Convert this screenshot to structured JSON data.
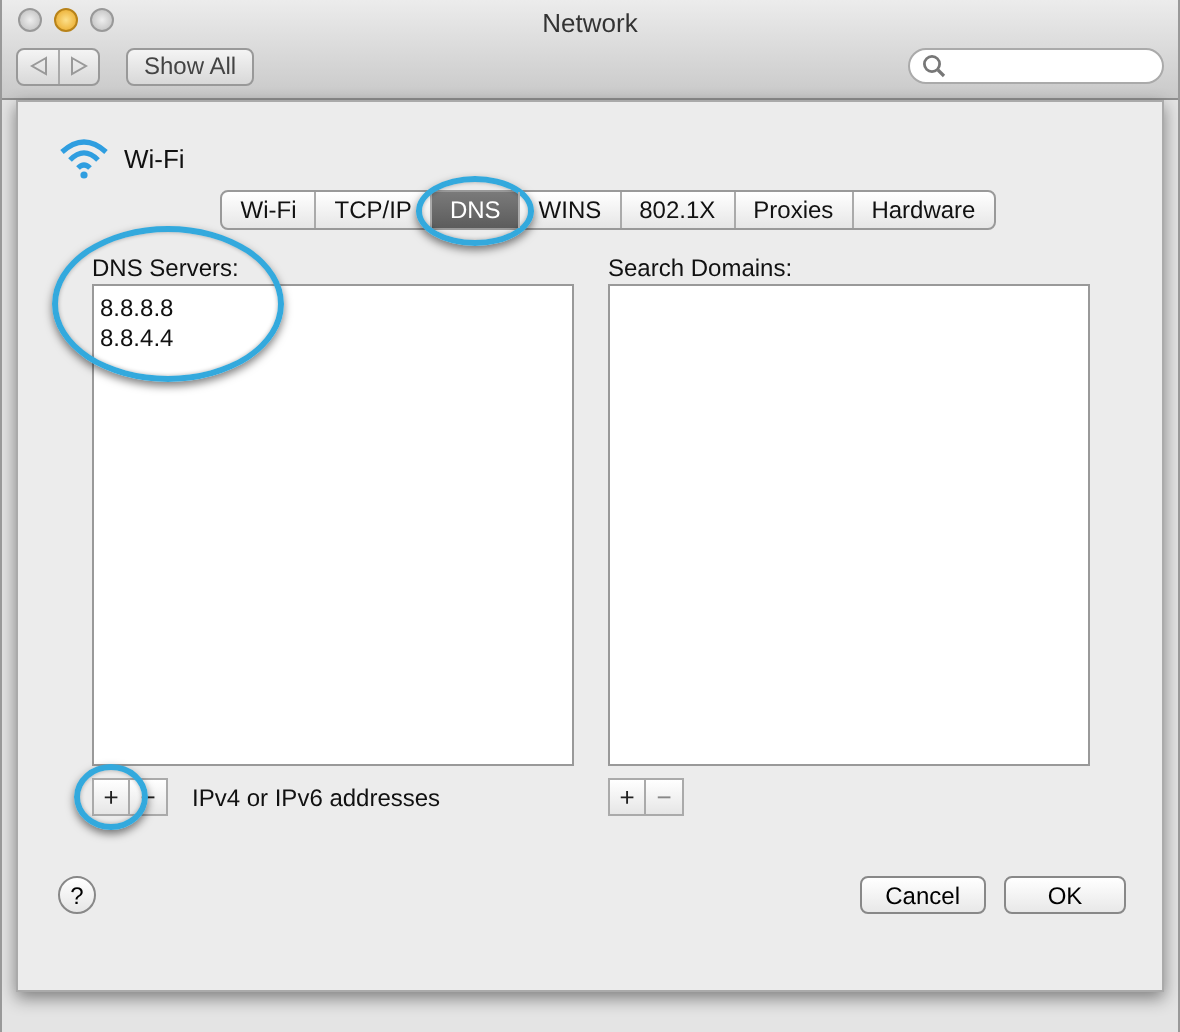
{
  "window": {
    "title": "Network"
  },
  "toolbar": {
    "show_all": "Show All"
  },
  "sheet": {
    "service": "Wi-Fi",
    "tabs": [
      {
        "label": "Wi-Fi",
        "selected": false,
        "highlighted": false
      },
      {
        "label": "TCP/IP",
        "selected": false,
        "highlighted": false
      },
      {
        "label": "DNS",
        "selected": true,
        "highlighted": true
      },
      {
        "label": "WINS",
        "selected": false,
        "highlighted": false
      },
      {
        "label": "802.1X",
        "selected": false,
        "highlighted": false
      },
      {
        "label": "Proxies",
        "selected": false,
        "highlighted": false
      },
      {
        "label": "Hardware",
        "selected": false,
        "highlighted": false
      }
    ],
    "dns_servers": {
      "label": "DNS Servers:",
      "highlighted": true,
      "entries": [
        "8.8.8.8",
        "8.8.4.4"
      ],
      "add_button": {
        "label": "+",
        "highlighted": true
      },
      "remove_button": {
        "label": "−"
      },
      "hint": "IPv4 or IPv6 addresses"
    },
    "search_domains": {
      "label": "Search Domains:",
      "add_button": {
        "label": "+"
      },
      "remove_button": {
        "label": "−"
      }
    },
    "help": "?",
    "buttons": [
      "Cancel",
      "OK"
    ]
  }
}
